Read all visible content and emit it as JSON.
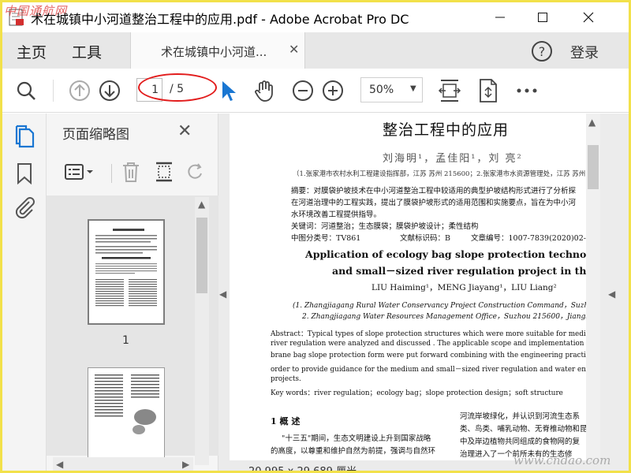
{
  "window": {
    "title": "术在城镇中小河道整治工程中的应用.pdf - Adobe Acrobat Pro DC",
    "watermark_top": "中国通航网"
  },
  "tabs": {
    "home": "主页",
    "tools": "工具",
    "document": "术在城镇中小河道...",
    "login": "登录"
  },
  "toolbar": {
    "page_current": "1",
    "page_total": "/ 5",
    "zoom": "50%"
  },
  "panel": {
    "title": "页面缩略图",
    "thumb_1_label": "1"
  },
  "document": {
    "title": "整治工程中的应用",
    "authors": "刘海明¹，孟佳阳¹，刘 亮²",
    "affiliation": "（1.张家港市农村水利工程建设指挥部，江苏 苏州 215600；2.张家港市水资源管理处，江苏 苏州",
    "abstract_cn_1": "摘要：对膜袋护坡技术在中小河道整治工程中较适用的典型护坡结构形式进行了分析探",
    "abstract_cn_2": "在河道治理中的工程实践，提出了膜袋护坡形式的适用范围和实施要点，旨在为中小河",
    "abstract_cn_3": "水环境改善工程提供指导。",
    "keywords_cn": "关键词：河道整治；生态膜袋；膜袋护坡设计；柔性结构",
    "class_no": "中图分类号：TV861",
    "doc_code": "文献标识码：B",
    "article_no": "文章编号：1007-7839(2020)02-0016-05",
    "en_title_1": "Application of ecology bag slope protection technology in medi",
    "en_title_2": "and small－sized river regulation project in the town",
    "en_authors": "LIU Haiming¹，MENG Jiayang¹，LIU Liang²",
    "en_affil_1": "(1. Zhangjiagang Rural Water Conservancy Project Construction Command，Suzhou 215600，",
    "en_affil_2": "2. Zhangjiagang Water Resources Management Office，Suzhou 215600，Jiangsu)",
    "en_abs_1": "Abstract：Typical types of slope protection structures which were more suitable for medium and",
    "en_abs_2": "river regulation were analyzed and discussed . The applicable scope and implementation points",
    "en_abs_3": "brane bag slope protection form were put forward combining with the engineering practice in river",
    "en_abs_4": "order to provide guidance for the medium and small－sized river regulation and water environmen",
    "en_abs_5": "projects.",
    "en_keywords": "Key words：river regulation；ecology bag；slope protection design；soft structure",
    "section_1": "1  概  述",
    "body_l1": "\"十三五\"期间，生态文明建设上升到国家战略",
    "body_l2": "的高度，以尊重和维护自然为前提，强调与自然环",
    "body_r1": "河流岸坡绿化，并认识到河流生态系",
    "body_r2": "类、鸟类、哺乳动物、无脊椎动物和昆",
    "body_r3": "中及岸边植物共同组成的食物网的复",
    "body_r4": "治理进入了一个前所未有的生态修"
  },
  "status": {
    "page_size": "20.995 x 29.689 厘米",
    "watermark_bottom": "www.cndao.com"
  }
}
